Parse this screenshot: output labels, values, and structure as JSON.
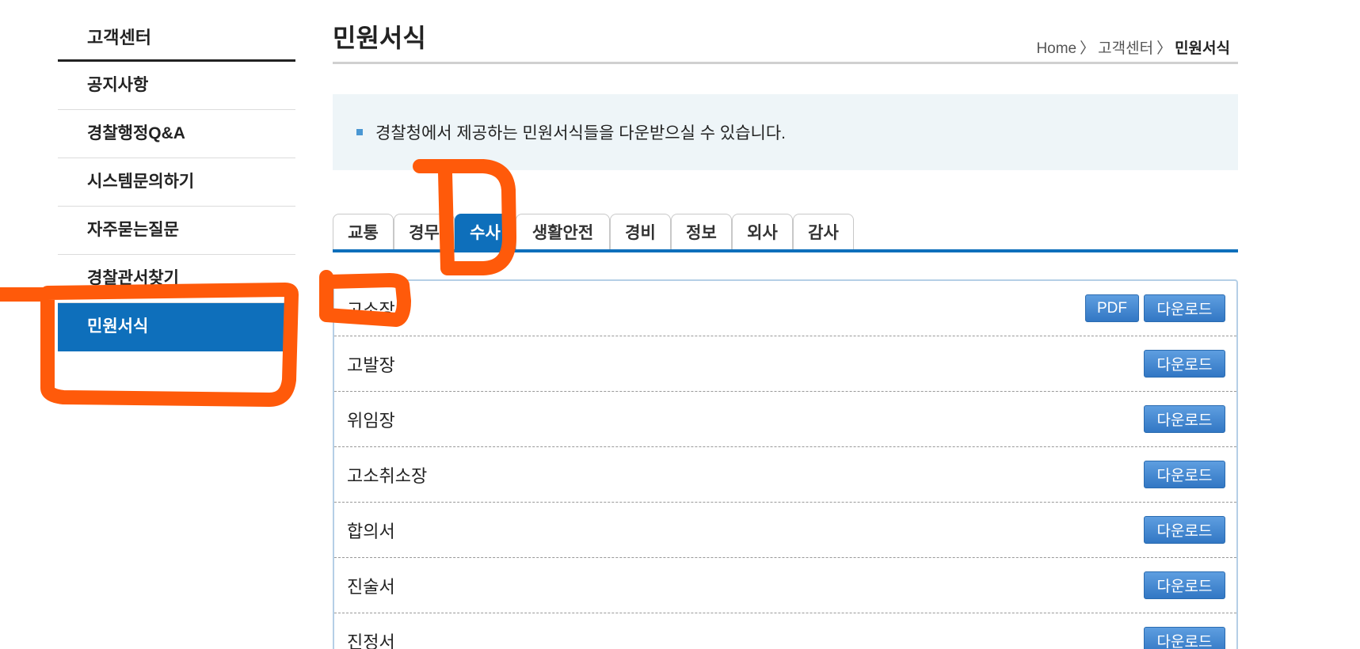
{
  "sidebar": {
    "title": "고객센터",
    "items": [
      {
        "label": "공지사항",
        "active": false
      },
      {
        "label": "경찰행정Q&A",
        "active": false
      },
      {
        "label": "시스템문의하기",
        "active": false
      },
      {
        "label": "자주묻는질문",
        "active": false
      },
      {
        "label": "경찰관서찾기",
        "active": false
      },
      {
        "label": "민원서식",
        "active": true
      }
    ]
  },
  "header": {
    "title": "민원서식",
    "breadcrumb": [
      "Home",
      "고객센터",
      "민원서식"
    ],
    "breadcrumb_sep": "〉"
  },
  "info": {
    "text": "경찰청에서 제공하는 민원서식들을 다운받으실 수 있습니다."
  },
  "tabs": [
    {
      "label": "교통",
      "active": false
    },
    {
      "label": "경무",
      "active": false
    },
    {
      "label": "수사",
      "active": true
    },
    {
      "label": "생활안전",
      "active": false
    },
    {
      "label": "경비",
      "active": false
    },
    {
      "label": "정보",
      "active": false
    },
    {
      "label": "외사",
      "active": false
    },
    {
      "label": "감사",
      "active": false
    }
  ],
  "forms": [
    {
      "name": "고소장",
      "pdf_label": "PDF",
      "download_label": "다운로드"
    },
    {
      "name": "고발장",
      "download_label": "다운로드"
    },
    {
      "name": "위임장",
      "download_label": "다운로드"
    },
    {
      "name": "고소취소장",
      "download_label": "다운로드"
    },
    {
      "name": "합의서",
      "download_label": "다운로드"
    },
    {
      "name": "진술서",
      "download_label": "다운로드"
    },
    {
      "name": "진정서",
      "download_label": "다운로드"
    }
  ],
  "colors": {
    "accent": "#0e6fbb",
    "annotation": "#ff5a0a",
    "button": "#3277c4"
  }
}
